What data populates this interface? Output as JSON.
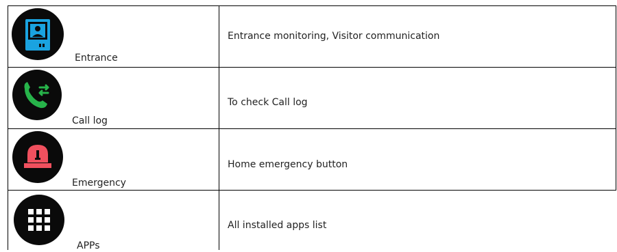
{
  "rows": [
    {
      "icon": "entrance-intercom-icon",
      "label": "Entrance",
      "description": "Entrance monitoring, Visitor communication"
    },
    {
      "icon": "call-log-icon",
      "label": "Call log",
      "description": "To check Call log"
    },
    {
      "icon": "emergency-siren-icon",
      "label": "Emergency",
      "description": "Home emergency button"
    },
    {
      "icon": "apps-grid-icon",
      "label": "APPs",
      "description": "All installed apps list"
    }
  ],
  "colors": {
    "icon_background": "#0a0a0a",
    "entrance_accent": "#1aa3e0",
    "call_log_accent": "#27b34a",
    "emergency_accent": "#f0505e",
    "apps_accent": "#ffffff"
  }
}
